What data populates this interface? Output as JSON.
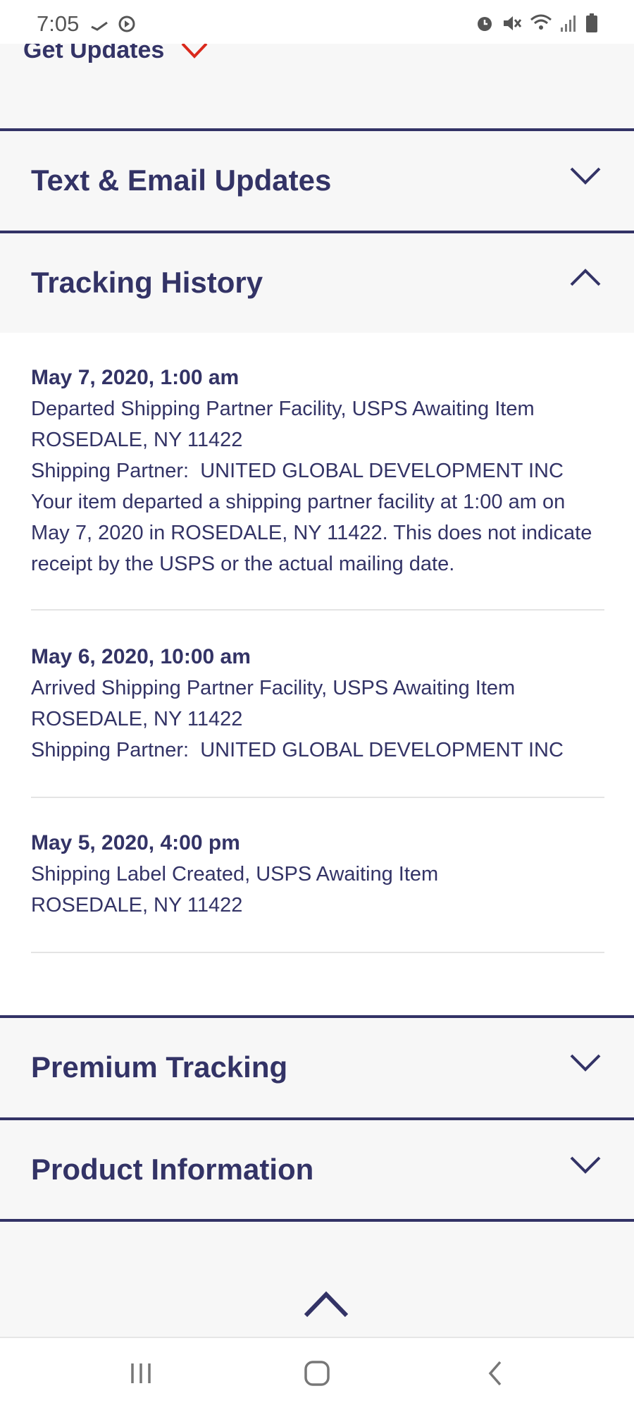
{
  "status_bar": {
    "time": "7:05"
  },
  "get_updates": {
    "label": "Get Updates",
    "chevron_color": "#da291c"
  },
  "sections": {
    "text_email": {
      "title": "Text & Email Updates",
      "expanded": false
    },
    "tracking_history": {
      "title": "Tracking History",
      "expanded": true
    },
    "premium_tracking": {
      "title": "Premium Tracking",
      "expanded": false
    },
    "product_information": {
      "title": "Product Information",
      "expanded": false
    }
  },
  "tracking_events": [
    {
      "date": "May 7, 2020, 1:00 am",
      "status": "Departed Shipping Partner Facility, USPS Awaiting Item",
      "location": "ROSEDALE, NY 11422",
      "partner_label": "Shipping Partner:",
      "partner": "UNITED GLOBAL DEVELOPMENT INC",
      "description": "Your item departed a shipping partner facility at 1:00 am on May 7, 2020 in ROSEDALE, NY 11422. This does not indicate receipt by the USPS or the actual mailing date."
    },
    {
      "date": "May 6, 2020, 10:00 am",
      "status": "Arrived Shipping Partner Facility, USPS Awaiting Item",
      "location": "ROSEDALE, NY 11422",
      "partner_label": "Shipping Partner:",
      "partner": "UNITED GLOBAL DEVELOPMENT INC"
    },
    {
      "date": "May 5, 2020, 4:00 pm",
      "status": "Shipping Label Created, USPS Awaiting Item",
      "location": "ROSEDALE, NY 11422"
    }
  ],
  "colors": {
    "navy": "#333366",
    "accent_red": "#da291c",
    "background": "#f7f7f7"
  },
  "icons": {
    "scroll_top": "chevron-up-icon",
    "nav_recents": "recents-icon",
    "nav_home": "home-icon",
    "nav_back": "back-icon"
  }
}
